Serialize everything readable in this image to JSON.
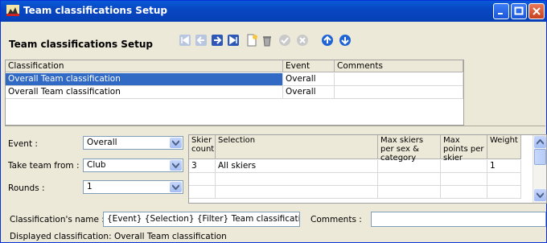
{
  "window": {
    "title": "Team classifications Setup"
  },
  "toolbar": {
    "title": "Team classifications Setup",
    "buttons": [
      "first-icon",
      "prev-icon",
      "next-icon",
      "last-icon",
      "new-icon",
      "delete-icon",
      "confirm-icon",
      "cancel-icon",
      "up-icon",
      "down-icon"
    ]
  },
  "classifications": {
    "headers": {
      "classification": "Classification",
      "event": "Event",
      "comments": "Comments"
    },
    "rows": [
      {
        "classification": "Overall Team classification",
        "event": "Overall",
        "comments": ""
      },
      {
        "classification": "Overall Team classification",
        "event": "Overall",
        "comments": ""
      }
    ]
  },
  "form": {
    "event_label": "Event :",
    "event_value": "Overall",
    "team_from_label": "Take team from :",
    "team_from_value": "Club",
    "rounds_label": "Rounds :",
    "rounds_value": "1",
    "name_label": "Classification's name :",
    "name_value": "{Event} {Selection} {Filter} Team classification",
    "comments_label": "Comments :",
    "comments_value": "",
    "displayed_label": "Displayed classification: Overall Team classification"
  },
  "selection_grid": {
    "headers": {
      "skier_count": "Skier count",
      "selection": "Selection",
      "max_skiers": "Max skiers per sex & category",
      "max_points": "Max points per skier",
      "weight": "Weight"
    },
    "rows": [
      {
        "skier_count": "3",
        "selection": "All skiers",
        "max_skiers": "",
        "max_points": "",
        "weight": "1"
      }
    ]
  },
  "colors": {
    "title_bar": "#0a5ad8",
    "selection": "#316ac5",
    "background": "#ece9d8"
  }
}
